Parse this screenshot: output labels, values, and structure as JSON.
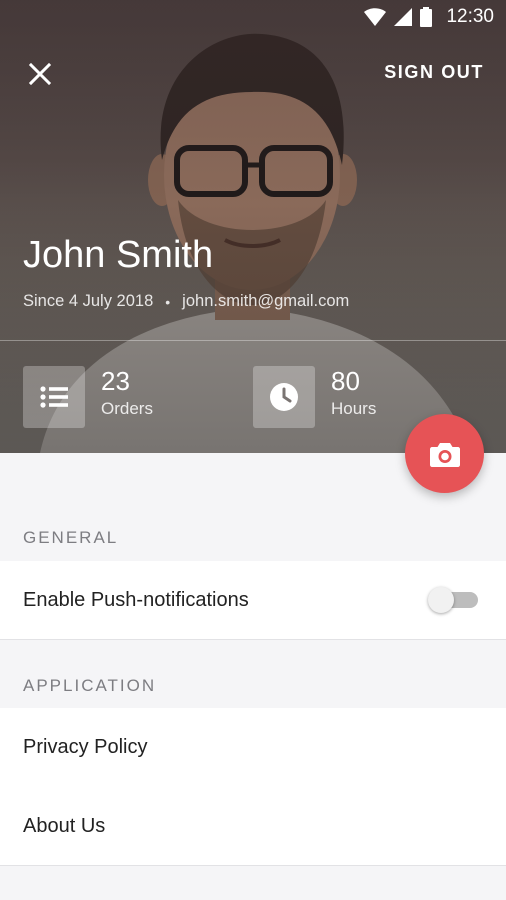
{
  "status_bar": {
    "time": "12:30"
  },
  "header": {
    "sign_out_label": "SIGN OUT"
  },
  "profile": {
    "name": "John Smith",
    "since": "Since 4 July 2018",
    "separator": "•",
    "email": "john.smith@gmail.com"
  },
  "stats": [
    {
      "value": "23",
      "label": "Orders",
      "icon": "list-icon"
    },
    {
      "value": "80",
      "label": "Hours",
      "icon": "clock-icon"
    }
  ],
  "general": {
    "header": "GENERAL",
    "push_label": "Enable Push-notifications",
    "push_enabled": false
  },
  "application": {
    "header": "APPLICATION",
    "items": [
      {
        "label": "Privacy Policy"
      },
      {
        "label": "About Us"
      }
    ]
  },
  "colors": {
    "accent": "#e65356",
    "background": "#f5f5f7",
    "section_header": "#7d7d82"
  }
}
